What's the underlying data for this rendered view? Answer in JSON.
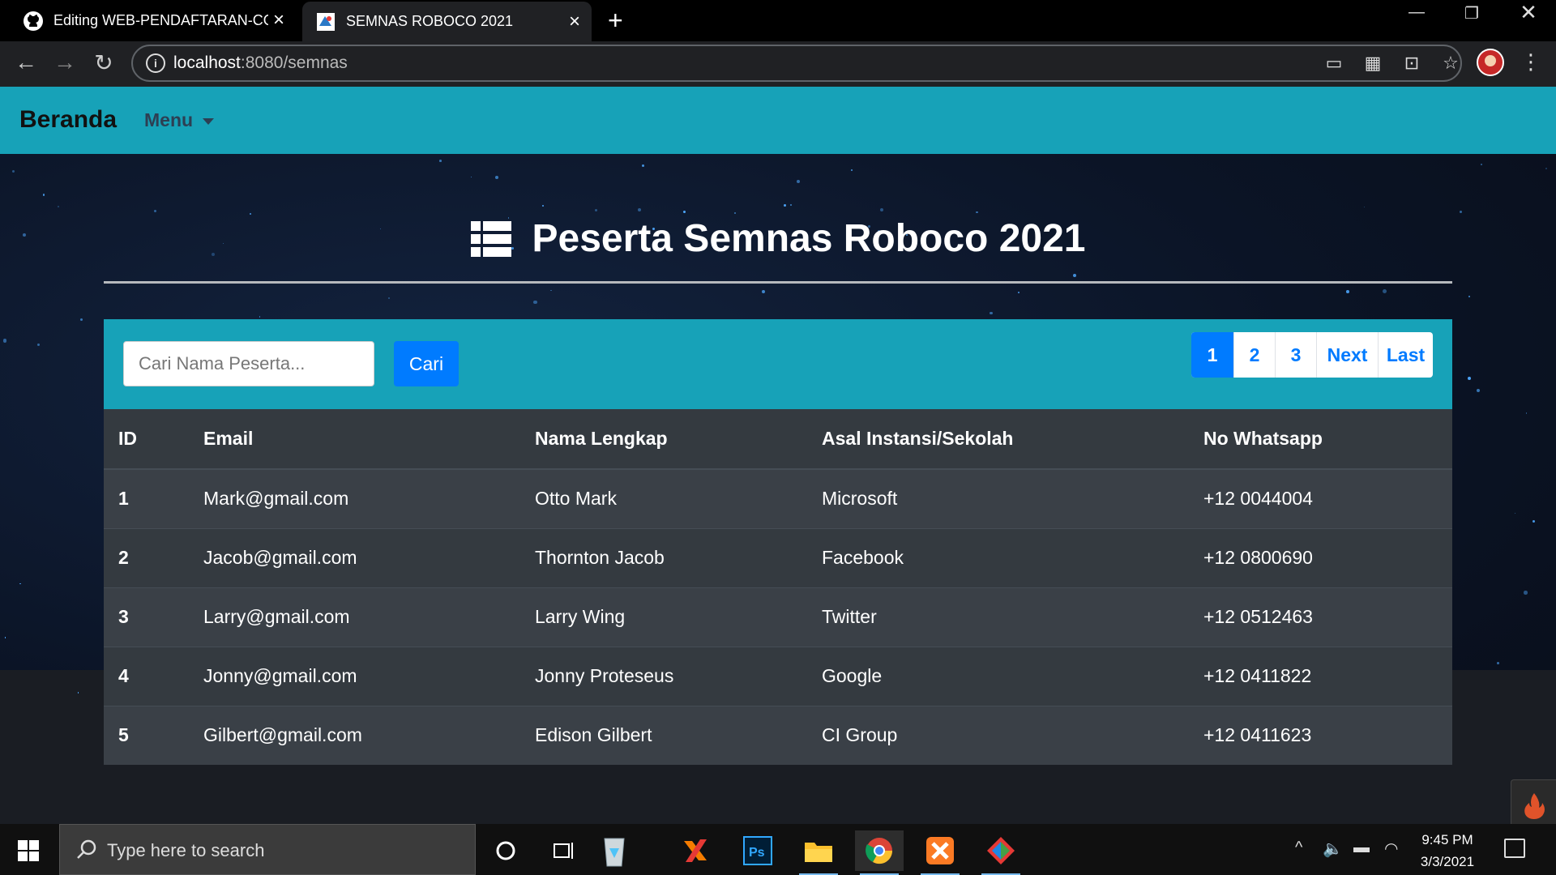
{
  "browser": {
    "tabs": [
      {
        "title": "Editing WEB-PENDAFTARAN-CO",
        "icon": "github-icon"
      },
      {
        "title": "SEMNAS ROBOCO 2021",
        "icon": "site-favicon-icon"
      }
    ],
    "url_host": "localhost",
    "url_rest": ":8080/semnas"
  },
  "navbar": {
    "brand": "Beranda",
    "menu_label": "Menu",
    "color": "#17a2b8"
  },
  "page": {
    "title": "Peserta Semnas Roboco 2021",
    "search_placeholder": "Cari Nama Peserta...",
    "search_button": "Cari",
    "pagination": [
      "1",
      "2",
      "3",
      "Next",
      "Last"
    ],
    "active_page": "1"
  },
  "table": {
    "headers": [
      "ID",
      "Email",
      "Nama Lengkap",
      "Asal Instansi/Sekolah",
      "No Whatsapp"
    ],
    "rows": [
      [
        "1",
        "Mark@gmail.com",
        "Otto Mark",
        "Microsoft",
        "+12 0044004"
      ],
      [
        "2",
        "Jacob@gmail.com",
        "Thornton Jacob",
        "Facebook",
        "+12 0800690"
      ],
      [
        "3",
        "Larry@gmail.com",
        "Larry Wing",
        "Twitter",
        "+12 0512463"
      ],
      [
        "4",
        "Jonny@gmail.com",
        "Jonny Proteseus",
        "Google",
        "+12 0411822"
      ],
      [
        "5",
        "Gilbert@gmail.com",
        "Edison Gilbert",
        "CI Group",
        "+12 0411623"
      ]
    ]
  },
  "taskbar": {
    "search_placeholder": "Type here to search",
    "time": "9:45 PM",
    "date": "3/3/2021"
  }
}
